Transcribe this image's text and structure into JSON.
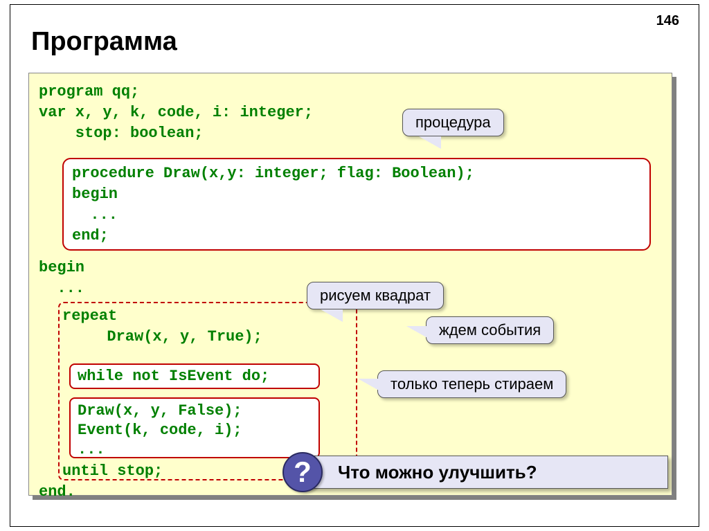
{
  "page_number": "146",
  "title": "Программа",
  "code": {
    "l1": "program qq;",
    "l2": "var x, y, k, code, i: integer;",
    "l3": "    stop: boolean;",
    "proc_l1": "procedure Draw(x,y: integer; flag: Boolean);",
    "proc_l2": "begin",
    "proc_l3": "  ...",
    "proc_l4": "end;",
    "l4": "begin",
    "l5": "  ...",
    "l6": "repeat",
    "l7": "  Draw(x, y, True);",
    "inset1": "while not IsEvent do;",
    "inset2_l1": "Draw(x, y, False);",
    "inset2_l2": "Event(k, code, i);",
    "inset2_l3": "...",
    "l8": "until stop;",
    "l9": "end."
  },
  "callouts": {
    "procedure": "процедура",
    "draw_square": "рисуем квадрат",
    "wait_event": "ждем события",
    "erase_now": "только теперь стираем"
  },
  "question": "Что можно улучшить?",
  "question_mark": "?"
}
